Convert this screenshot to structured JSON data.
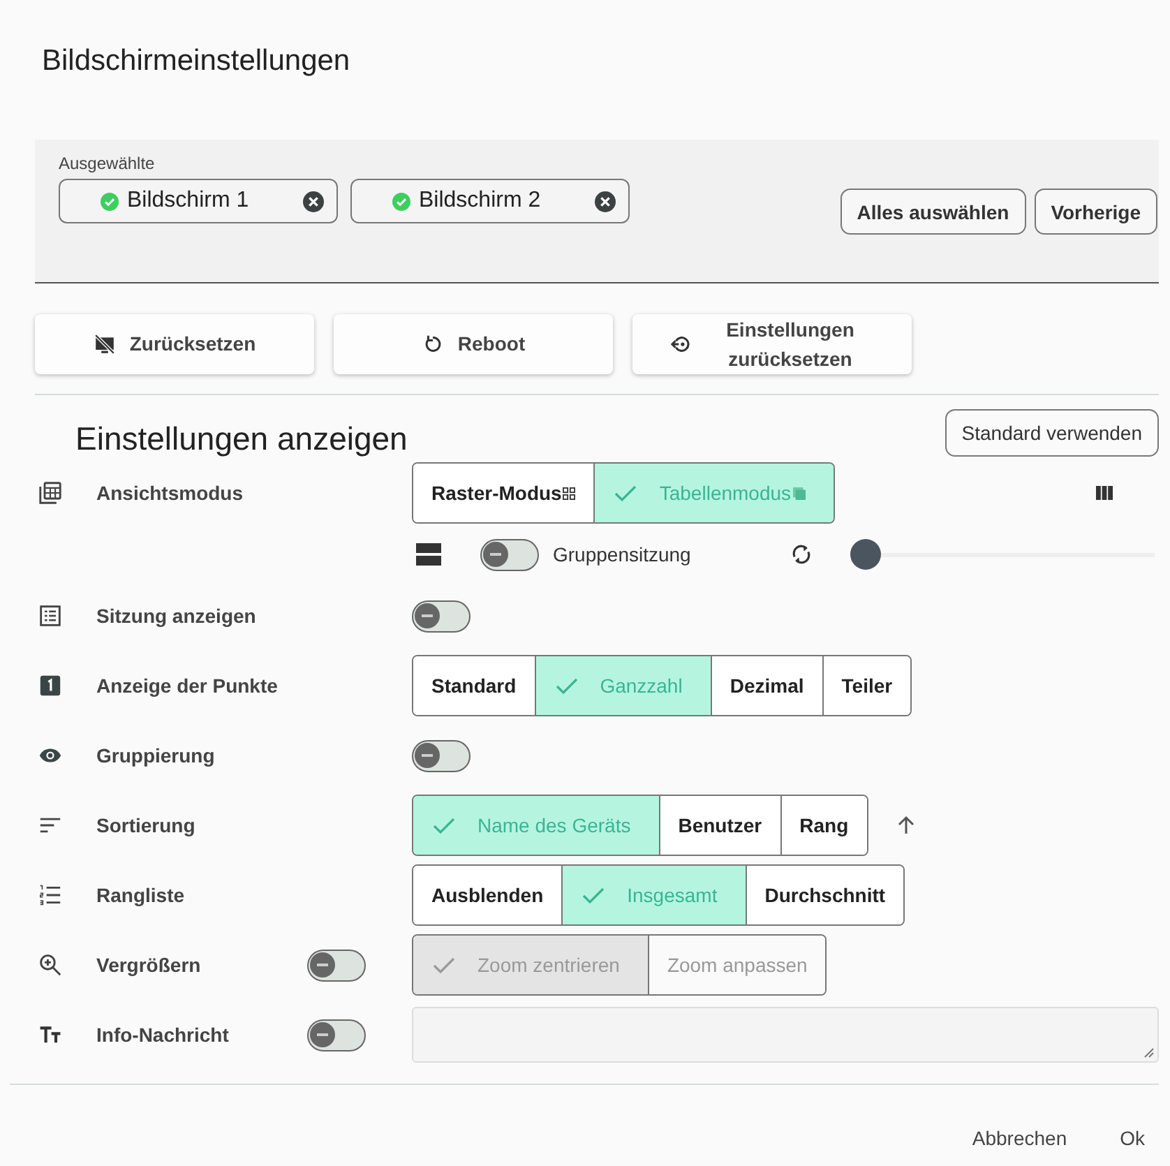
{
  "dialog": {
    "title": "Bildschirmeinstellungen"
  },
  "selection": {
    "label": "Ausgewählte",
    "chips": [
      {
        "label": "Bildschirm 1"
      },
      {
        "label": "Bildschirm 2"
      }
    ],
    "buttons": [
      "Alles auswählen",
      "Vorherige"
    ]
  },
  "actions": [
    {
      "label": "Zurücksetzen"
    },
    {
      "label": "Reboot"
    },
    {
      "label": "Einstellungen zurücksetzen"
    }
  ],
  "display": {
    "heading": "Einstellungen anzeigen",
    "default_button": "Standard verwenden",
    "settings": [
      {
        "kind": "segmented",
        "label": "Ansichtsmodus",
        "options": [
          {
            "label": "Raster-Modus",
            "selected": false
          },
          {
            "label": "Tabellenmodus",
            "selected": true
          }
        ],
        "sub": {
          "toggle": {
            "label": "Gruppensitzung",
            "on": false
          },
          "slider": {
            "level": 0
          }
        }
      },
      {
        "kind": "toggle",
        "label": "Sitzung anzeigen",
        "on": false
      },
      {
        "kind": "segmented",
        "label": "Anzeige der Punkte",
        "options": [
          {
            "label": "Standard",
            "selected": false
          },
          {
            "label": "Ganzzahl",
            "selected": true
          },
          {
            "label": "Dezimal",
            "selected": false
          },
          {
            "label": "Teiler",
            "selected": false
          }
        ]
      },
      {
        "kind": "toggle",
        "label": "Gruppierung",
        "on": false
      },
      {
        "kind": "segmented",
        "label": "Sortierung",
        "options": [
          {
            "label": "Name des Geräts",
            "selected": true
          },
          {
            "label": "Benutzer",
            "selected": false
          },
          {
            "label": "Rang",
            "selected": false
          }
        ]
      },
      {
        "kind": "segmented",
        "label": "Rangliste",
        "options": [
          {
            "label": "Ausblenden",
            "selected": false
          },
          {
            "label": "Insgesamt",
            "selected": true
          },
          {
            "label": "Durchschnitt",
            "selected": false
          }
        ]
      },
      {
        "kind": "toggle_segmented",
        "label": "Vergrößern",
        "on": false,
        "options": [
          {
            "label": "Zoom zentrieren",
            "selected": true
          },
          {
            "label": "Zoom anpassen",
            "selected": false
          }
        ]
      },
      {
        "kind": "toggle_field",
        "label": "Info-Nachricht",
        "on": false
      }
    ]
  },
  "footer": {
    "buttons": [
      "Abbrechen",
      "Ok"
    ]
  }
}
